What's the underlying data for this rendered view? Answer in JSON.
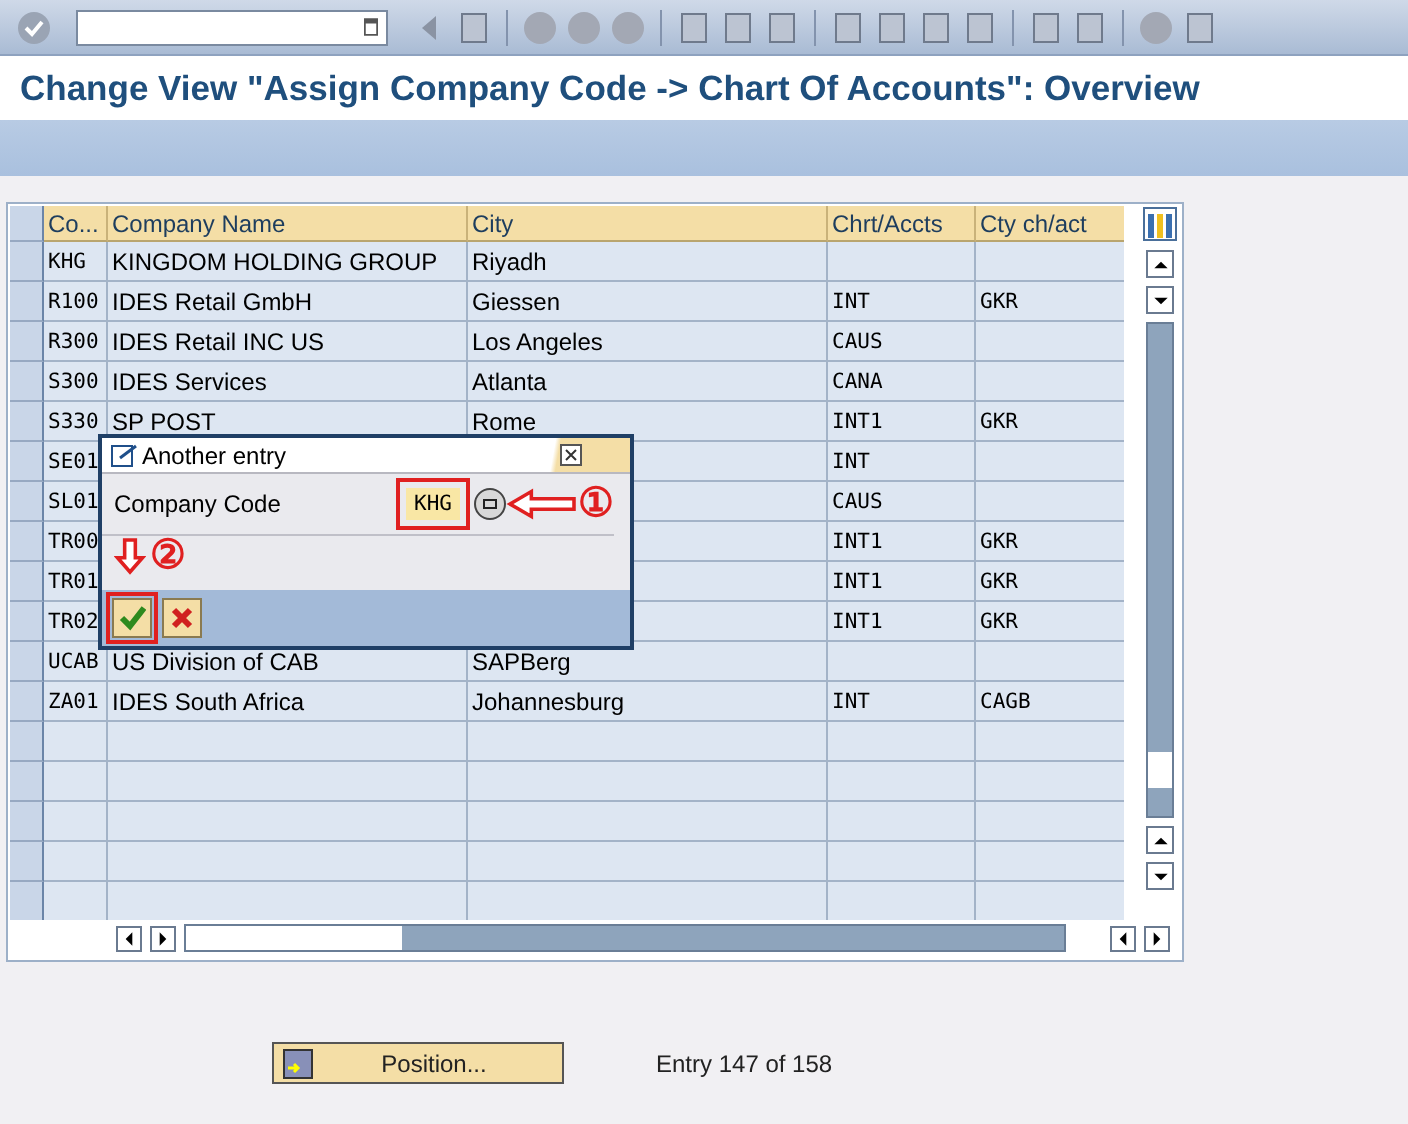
{
  "title": "Change View \"Assign Company Code -> Chart Of Accounts\": Overview",
  "table": {
    "columns": [
      "Co...",
      "Company Name",
      "City",
      "Chrt/Accts",
      "Cty ch/act"
    ],
    "rows": [
      {
        "code": "KHG",
        "name": "KINGDOM HOLDING GROUP",
        "city": "Riyadh"
      },
      {
        "code": "R100",
        "name": "IDES Retail GmbH",
        "city": "Giessen",
        "chart": "INT",
        "country_chart": "GKR"
      },
      {
        "code": "R300",
        "name": "IDES Retail INC US",
        "city": "Los Angeles",
        "chart": "CAUS"
      },
      {
        "code": "S300",
        "name": "IDES Services",
        "city": "Atlanta",
        "chart": "CANA"
      },
      {
        "code": "S330",
        "name": "SP POST",
        "city": "Rome",
        "chart": "INT1",
        "country_chart": "GKR"
      },
      {
        "code": "SE01",
        "chart": "INT"
      },
      {
        "code": "SL01",
        "chart": "CAUS"
      },
      {
        "code": "TR00",
        "chart": "INT1",
        "country_chart": "GKR"
      },
      {
        "code": "TR01",
        "chart": "INT1",
        "country_chart": "GKR"
      },
      {
        "code": "TR02",
        "chart": "INT1",
        "country_chart": "GKR"
      },
      {
        "code": "UCAB",
        "name": "US Division of CAB",
        "city": "SAPBerg"
      },
      {
        "code": "ZA01",
        "name": "IDES South Africa",
        "city": "Johannesburg",
        "chart": "INT",
        "country_chart": "CAGB"
      },
      {},
      {},
      {},
      {},
      {}
    ]
  },
  "dialog": {
    "title": "Another entry",
    "field_label": "Company Code",
    "field_value": "KHG",
    "annotations": [
      "①",
      "②"
    ]
  },
  "footer": {
    "position_button": "Position...",
    "entry_info": "Entry 147 of 158"
  }
}
